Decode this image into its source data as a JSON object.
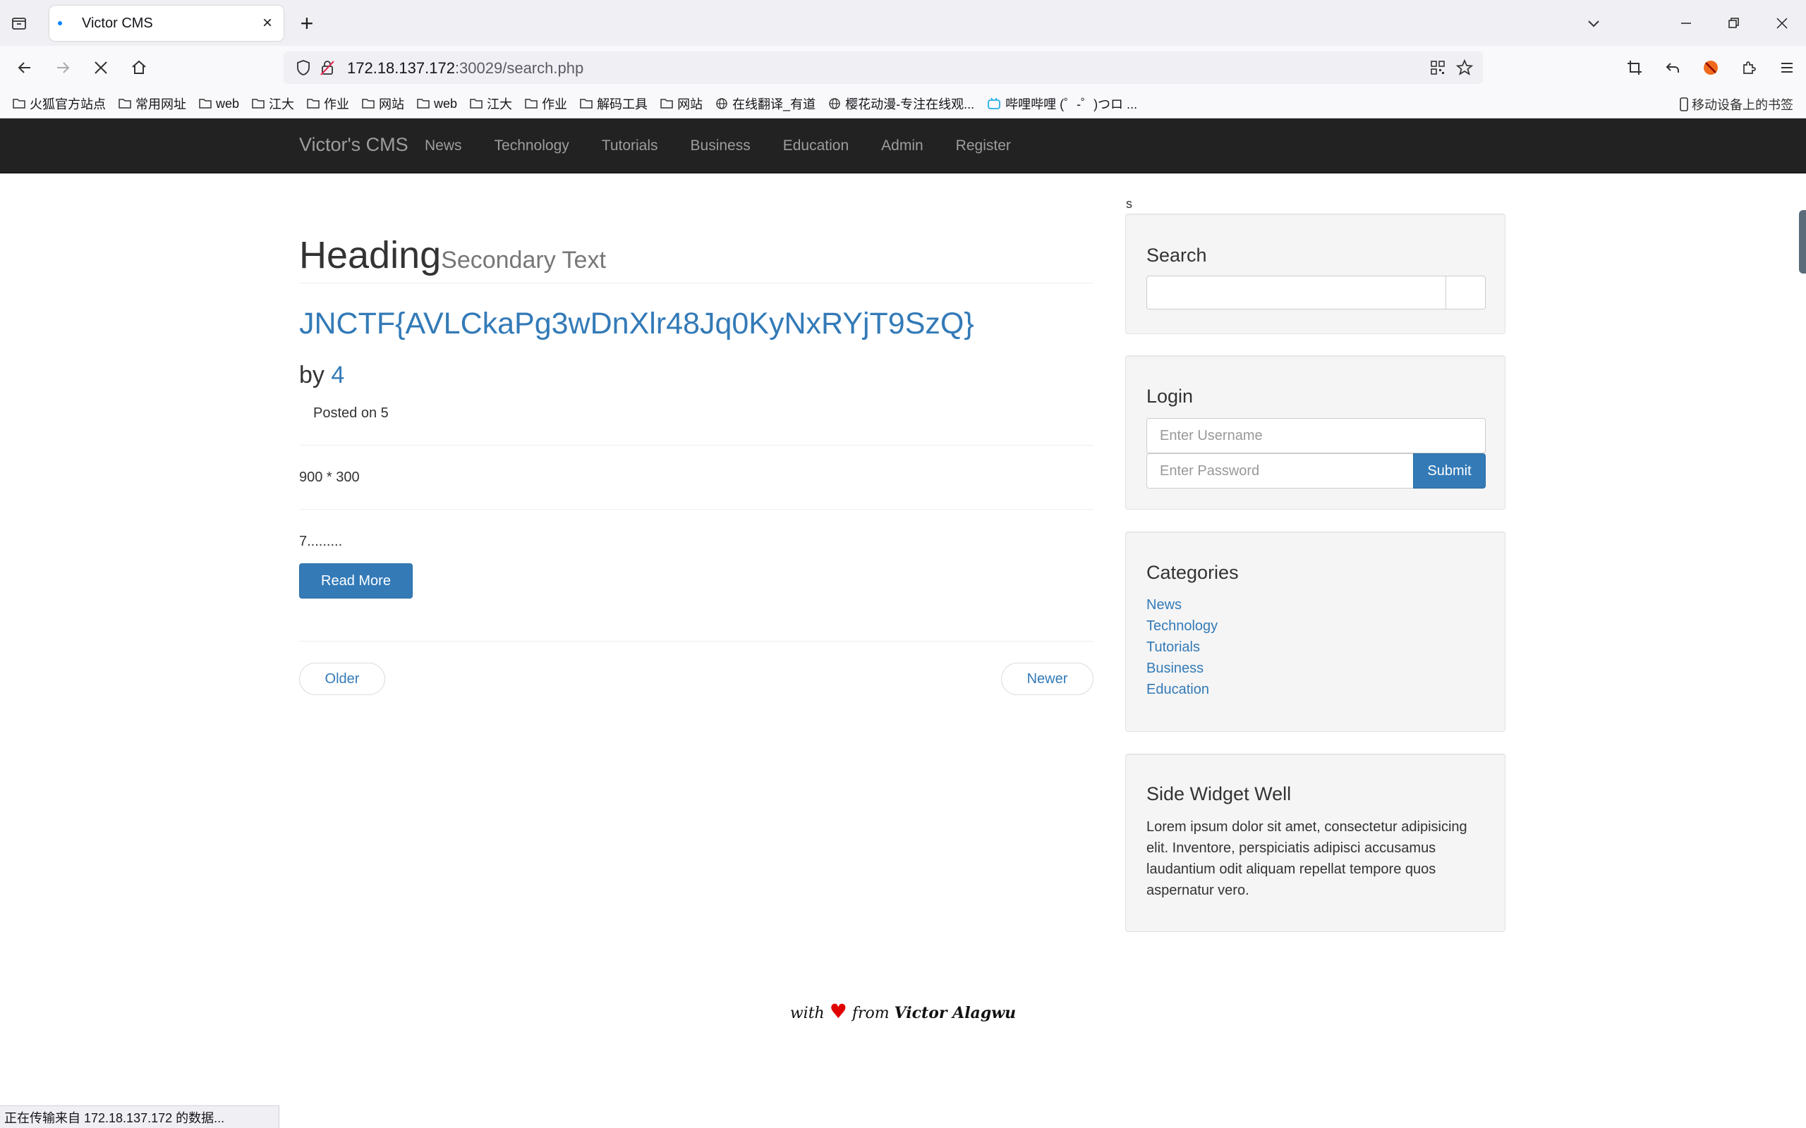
{
  "browser": {
    "tab_title": "Victor CMS",
    "url_host": "172.18.137.172",
    "url_path": ":30029/search.php",
    "bookmarks": [
      "火狐官方站点",
      "常用网址",
      "web",
      "江大",
      "作业",
      "网站",
      "web",
      "江大",
      "作业",
      "解码工具",
      "网站",
      "在线翻译_有道",
      "樱花动漫-专注在线观...",
      "哔哩哔哩 (゜-゜)つロ ..."
    ],
    "mobile_bookmarks": "移动设备上的书签",
    "status_text": "正在传输来自 172.18.137.172 的数据..."
  },
  "site": {
    "brand": "Victor's CMS",
    "nav": [
      "News",
      "Technology",
      "Tutorials",
      "Business",
      "Education",
      "Admin",
      "Register"
    ]
  },
  "main": {
    "heading": "Heading",
    "heading_secondary": "Secondary Text",
    "post_title": "JNCTF{AVLCkaPg3wDnXlr48Jq0KyNxRYjT9SzQ}",
    "by_label": "by",
    "author": "4",
    "posted_on": "Posted on 5",
    "image_placeholder": "900 * 300",
    "excerpt": "7.........",
    "read_more": "Read More",
    "older": "Older",
    "newer": "Newer"
  },
  "sidebar": {
    "stray_text": "s",
    "search_title": "Search",
    "login_title": "Login",
    "username_placeholder": "Enter Username",
    "password_placeholder": "Enter Password",
    "submit_label": "Submit",
    "categories_title": "Categories",
    "categories": [
      "News",
      "Technology",
      "Tutorials",
      "Business",
      "Education"
    ],
    "widget_title": "Side Widget Well",
    "widget_text": "Lorem ipsum dolor sit amet, consectetur adipisicing elit. Inventore, perspiciatis adipisci accusamus laudantium odit aliquam repellat tempore quos aspernatur vero."
  },
  "footer": {
    "with": "with",
    "from": "from",
    "name": "Victor Alagwu"
  },
  "colors": {
    "navbar_bg": "#222222",
    "link": "#337ab7",
    "button_primary": "#337ab7",
    "heart": "#e00000"
  }
}
